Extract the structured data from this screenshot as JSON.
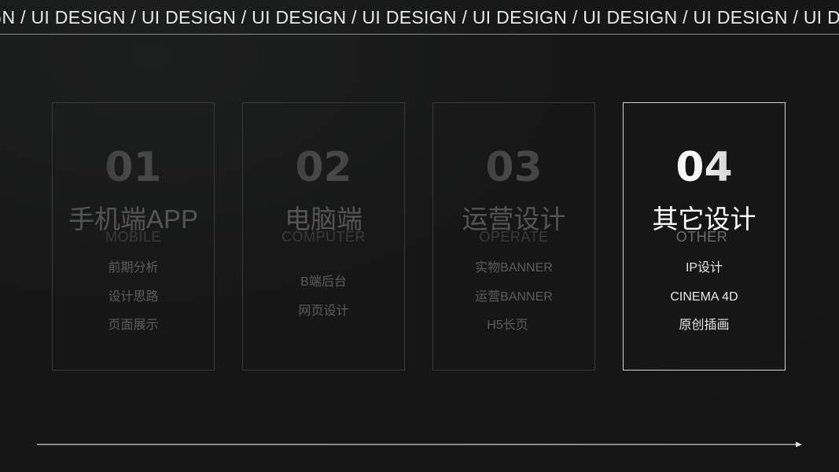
{
  "banner": {
    "text": "SIGN / UI DESIGN / UI DESIGN / UI DESIGN / UI DESIGN / UI DESIGN / UI DESIGN / UI DESIGN / UI DESIGN / UI DESIGN"
  },
  "cards": [
    {
      "number": "01",
      "title": "手机端APP",
      "subtitle": "MOBILE",
      "items": [
        "前期分析",
        "设计思路",
        "页面展示"
      ]
    },
    {
      "number": "02",
      "title": "电脑端",
      "subtitle": "COMPUTER",
      "items": [
        "B端后台",
        "网页设计"
      ]
    },
    {
      "number": "03",
      "title": "运营设计",
      "subtitle": "OPERATE",
      "items": [
        "实物BANNER",
        "运营BANNER",
        "H5长页"
      ]
    },
    {
      "number": "04",
      "title": "其它设计",
      "subtitle": "OTHER",
      "items": [
        "IP设计",
        "CINEMA 4D",
        "原创插画"
      ]
    }
  ],
  "colors": {
    "background": "#161616",
    "active_border": "#d4d4d4",
    "inactive_border": "#3a3a3a",
    "active_text": "#ffffff",
    "inactive_text": "#545454"
  }
}
